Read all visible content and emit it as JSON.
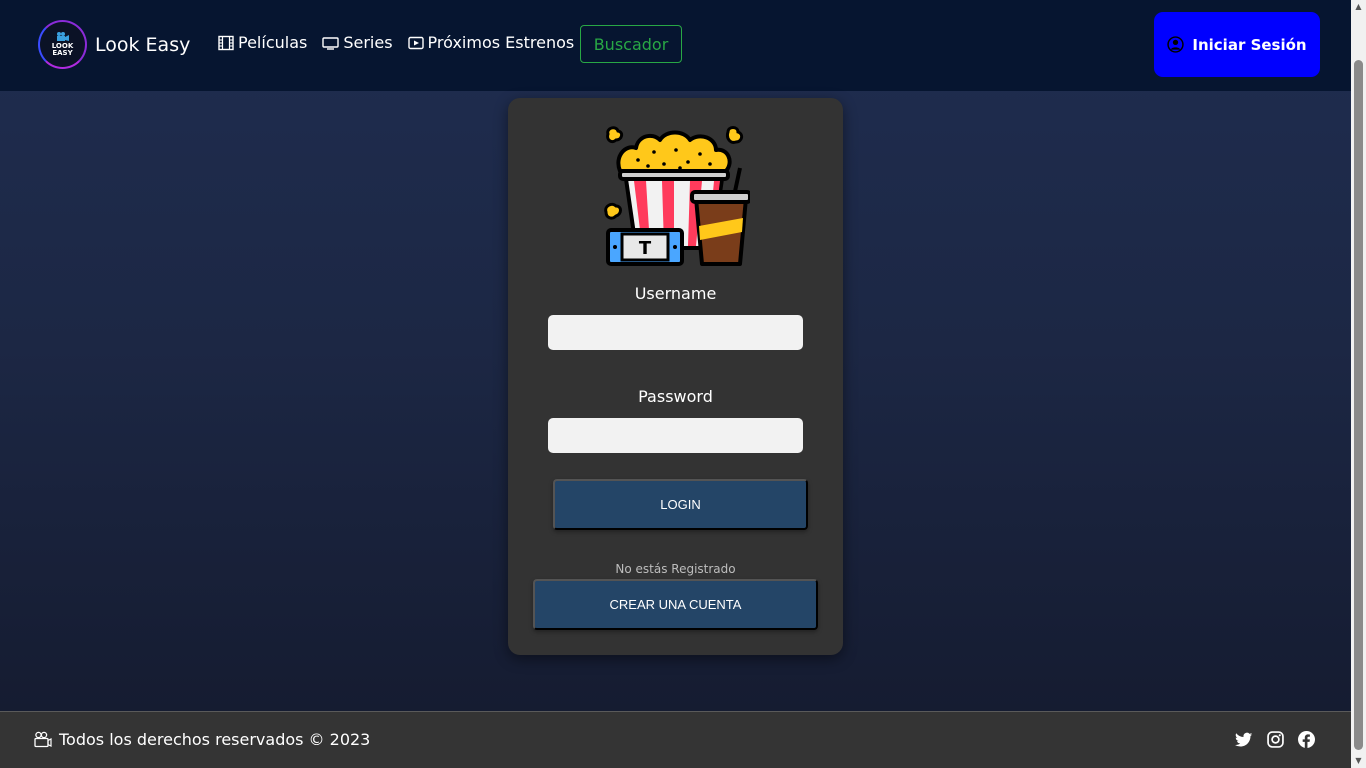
{
  "navbar": {
    "brand_name": "Look Easy",
    "logo_line1": "LOOK",
    "logo_line2": "EASY",
    "links": [
      {
        "label": "Películas",
        "icon": "film-icon"
      },
      {
        "label": "Series",
        "icon": "tv-icon"
      },
      {
        "label": "Próximos Estrenos",
        "icon": "play-icon"
      }
    ],
    "search_label": "Buscador",
    "login_label": "Iniciar Sesión",
    "search_color": "#28a745",
    "login_color": "#0000ff"
  },
  "login_form": {
    "image_icon": "popcorn-ticket-drink-icon",
    "username_label": "Username",
    "username_value": "",
    "password_label": "Password",
    "password_value": "",
    "login_button": "LOGIN",
    "not_registered_text": "No estás Registrado",
    "create_account_button": "CREAR UNA CUENTA",
    "button_color": "#244567"
  },
  "footer": {
    "copyright": "Todos los derechos reservados © 2023",
    "socials": [
      "twitter-icon",
      "instagram-icon",
      "facebook-icon"
    ]
  }
}
